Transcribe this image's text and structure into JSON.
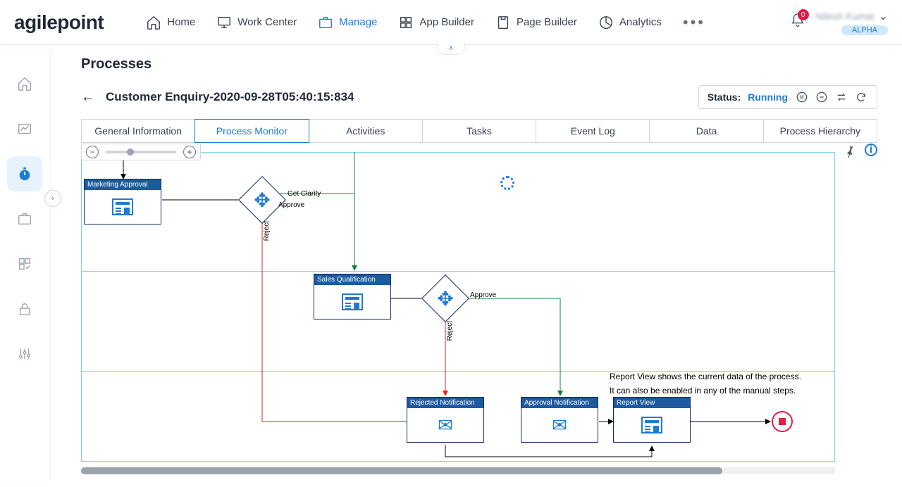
{
  "logo": "agilepoint",
  "nav": {
    "home": "Home",
    "work_center": "Work Center",
    "manage": "Manage",
    "app_builder": "App Builder",
    "page_builder": "Page Builder",
    "analytics": "Analytics"
  },
  "notifications": {
    "count": "0"
  },
  "user": {
    "name": "Nilesh Kumar",
    "badge": "ALPHA"
  },
  "page": {
    "title": "Processes"
  },
  "process": {
    "name": "Customer Enquiry-2020-09-28T05:40:15:834"
  },
  "status": {
    "label": "Status:",
    "value": "Running"
  },
  "tabs": {
    "general": "General Information",
    "monitor": "Process Monitor",
    "activities": "Activities",
    "tasks": "Tasks",
    "event_log": "Event Log",
    "data": "Data",
    "hierarchy": "Process Hierarchy"
  },
  "nodes": {
    "marketing_approval": "Marketing Approval",
    "sales_qualification": "Sales Qualification",
    "rejected_notification": "Rejected Notification",
    "approval_notification": "Approval Notification",
    "report_view": "Report View"
  },
  "edges": {
    "get_clarity": "Get Clarity",
    "approve": "Approve",
    "reject": "Reject"
  },
  "hints": {
    "line1": "Report View shows the current data of the process.",
    "line2": "It can also be enabled in any of the manual steps."
  }
}
